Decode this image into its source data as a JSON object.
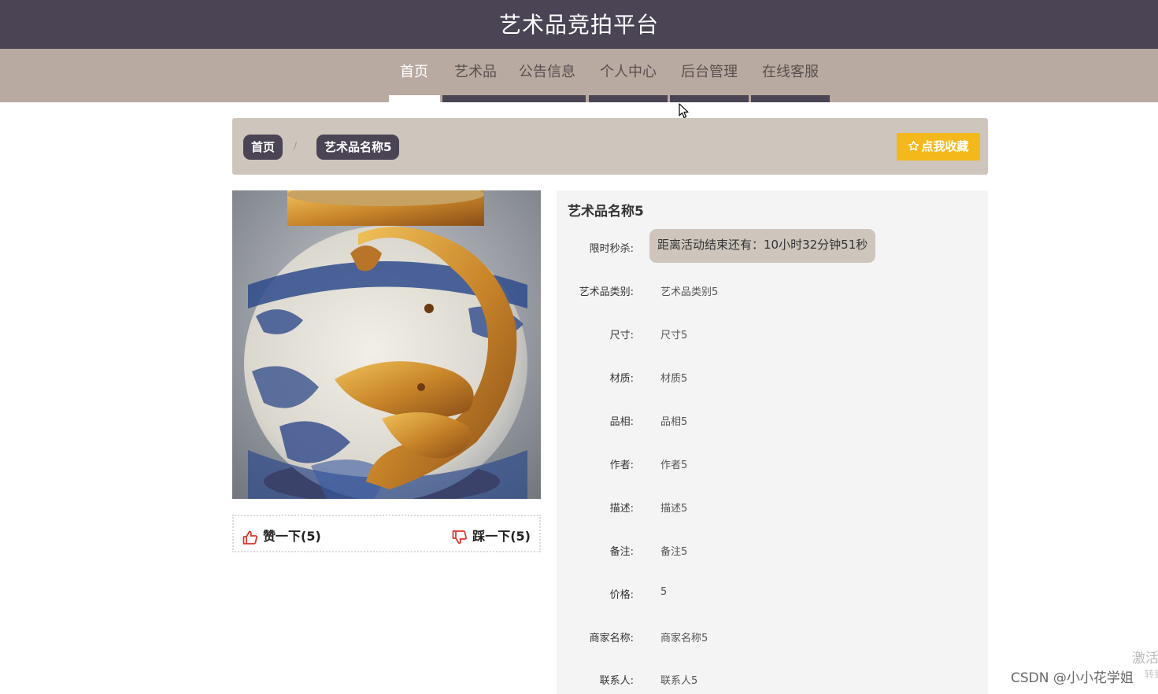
{
  "header": {
    "site_title": "艺术品竞拍平台"
  },
  "nav": {
    "items": [
      {
        "label": "首页",
        "active": true
      },
      {
        "label": "艺术品",
        "active": false
      },
      {
        "label": "公告信息",
        "active": false
      },
      {
        "label": "个人中心",
        "active": false
      },
      {
        "label": "后台管理",
        "active": false
      },
      {
        "label": "在线客服",
        "active": false
      }
    ]
  },
  "breadcrumb": {
    "home": "首页",
    "separator": "/",
    "current": "艺术品名称5"
  },
  "favorite_button": {
    "icon": "star-outline-icon",
    "label": "点我收藏"
  },
  "product_image": {
    "subject": "blue-and-white porcelain jar with gilded dragon"
  },
  "votes": {
    "like_label": "赞一下(5)",
    "dislike_label": "踩一下(5)",
    "like_icon": "thumbs-up-icon",
    "dislike_icon": "thumbs-down-icon"
  },
  "detail": {
    "title": "艺术品名称5",
    "flash_sale_label": "限时秒杀:",
    "countdown": "距离活动结束还有：10小时32分钟51秒",
    "fields": [
      {
        "label": "艺术品类别:",
        "value": "艺术品类别5"
      },
      {
        "label": "尺寸:",
        "value": "尺寸5"
      },
      {
        "label": "材质:",
        "value": "材质5"
      },
      {
        "label": "品相:",
        "value": "品相5"
      },
      {
        "label": "作者:",
        "value": "作者5"
      },
      {
        "label": "描述:",
        "value": "描述5"
      },
      {
        "label": "备注:",
        "value": "备注5"
      },
      {
        "label": "价格:",
        "value": "5"
      },
      {
        "label": "商家名称:",
        "value": "商家名称5"
      },
      {
        "label": "联系人:",
        "value": "联系人5"
      }
    ]
  },
  "overlay": {
    "watermark": "CSDN @小小花学姐",
    "activate_title": "激活",
    "activate_sub": "转到"
  },
  "colors": {
    "topbar": "#4a4454",
    "navbar": "#b8aaa0",
    "crumbbar": "#cec6bc",
    "accent_yellow": "#f3b81b",
    "vote_red": "#d9342b"
  }
}
